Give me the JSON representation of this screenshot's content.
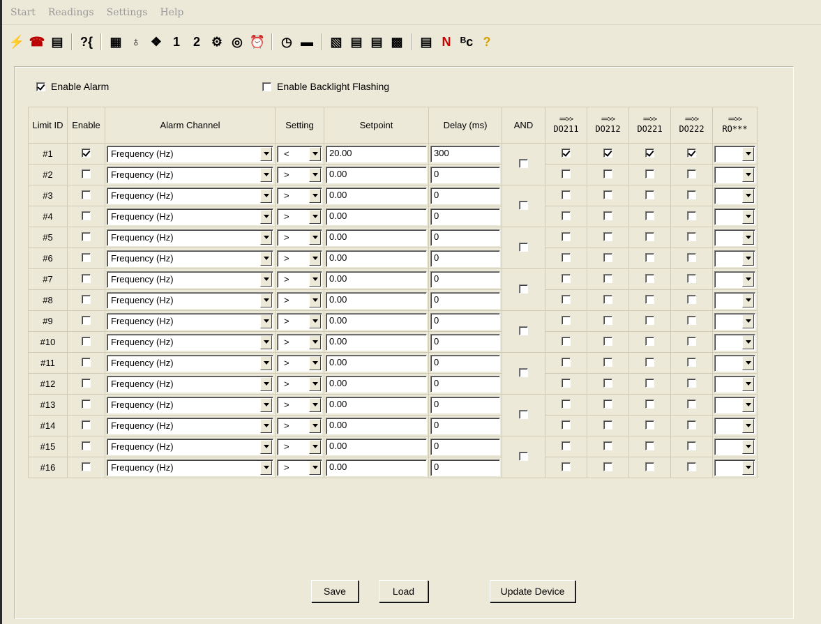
{
  "menu": [
    "Start",
    "Readings",
    "Settings",
    "Help"
  ],
  "toolbar_icons": [
    {
      "name": "connect-icon",
      "glyph": "⚡"
    },
    {
      "name": "phone-icon",
      "glyph": "☎"
    },
    {
      "name": "device-list-icon",
      "glyph": "▤"
    },
    {
      "name": "sep"
    },
    {
      "name": "query-icon",
      "glyph": "?{"
    },
    {
      "name": "sep"
    },
    {
      "name": "meter-icon",
      "glyph": "▦"
    },
    {
      "name": "lamp-icon",
      "glyph": "♁"
    },
    {
      "name": "cube-icon",
      "glyph": "❖"
    },
    {
      "name": "one-icon",
      "glyph": "1"
    },
    {
      "name": "two-icon",
      "glyph": "2"
    },
    {
      "name": "network-icon",
      "glyph": "⚙"
    },
    {
      "name": "target-icon",
      "glyph": "◎"
    },
    {
      "name": "alarm-clock-icon",
      "glyph": "⏰"
    },
    {
      "name": "sep"
    },
    {
      "name": "clock-icon",
      "glyph": "◷"
    },
    {
      "name": "battery-icon",
      "glyph": "▬"
    },
    {
      "name": "sep"
    },
    {
      "name": "document-icon",
      "glyph": "▧"
    },
    {
      "name": "document-1-icon",
      "glyph": "▤"
    },
    {
      "name": "document-2-icon",
      "glyph": "▤"
    },
    {
      "name": "grid-icon",
      "glyph": "▩"
    },
    {
      "name": "sep"
    },
    {
      "name": "document-n-icon",
      "glyph": "▤"
    },
    {
      "name": "n-icon",
      "glyph": "N"
    },
    {
      "name": "bc-icon",
      "glyph": "ᴮᴄ"
    },
    {
      "name": "help-icon",
      "glyph": "?"
    }
  ],
  "options": {
    "enable_alarm": {
      "label": "Enable Alarm",
      "checked": true
    },
    "enable_backlight": {
      "label": "Enable Backlight Flashing",
      "checked": false
    }
  },
  "headers": {
    "limit_id": "Limit ID",
    "enable": "Enable",
    "alarm_channel": "Alarm Channel",
    "setting": "Setting",
    "setpoint": "Setpoint",
    "delay": "Delay (ms)",
    "and": "AND",
    "arrow": "==>>",
    "do211": "DO211",
    "do212": "DO212",
    "do221": "DO221",
    "do222": "DO222",
    "ro": "RO***"
  },
  "rows": [
    {
      "id": "#1",
      "enable": true,
      "channel": "Frequency (Hz)",
      "setting": "<",
      "setpoint": "20.00",
      "delay": "300",
      "do": [
        true,
        true,
        true,
        true
      ]
    },
    {
      "id": "#2",
      "enable": false,
      "channel": "Frequency (Hz)",
      "setting": ">",
      "setpoint": "0.00",
      "delay": "0",
      "do": [
        false,
        false,
        false,
        false
      ]
    },
    {
      "id": "#3",
      "enable": false,
      "channel": "Frequency (Hz)",
      "setting": ">",
      "setpoint": "0.00",
      "delay": "0",
      "do": [
        false,
        false,
        false,
        false
      ]
    },
    {
      "id": "#4",
      "enable": false,
      "channel": "Frequency (Hz)",
      "setting": ">",
      "setpoint": "0.00",
      "delay": "0",
      "do": [
        false,
        false,
        false,
        false
      ]
    },
    {
      "id": "#5",
      "enable": false,
      "channel": "Frequency (Hz)",
      "setting": ">",
      "setpoint": "0.00",
      "delay": "0",
      "do": [
        false,
        false,
        false,
        false
      ]
    },
    {
      "id": "#6",
      "enable": false,
      "channel": "Frequency (Hz)",
      "setting": ">",
      "setpoint": "0.00",
      "delay": "0",
      "do": [
        false,
        false,
        false,
        false
      ]
    },
    {
      "id": "#7",
      "enable": false,
      "channel": "Frequency (Hz)",
      "setting": ">",
      "setpoint": "0.00",
      "delay": "0",
      "do": [
        false,
        false,
        false,
        false
      ]
    },
    {
      "id": "#8",
      "enable": false,
      "channel": "Frequency (Hz)",
      "setting": ">",
      "setpoint": "0.00",
      "delay": "0",
      "do": [
        false,
        false,
        false,
        false
      ]
    },
    {
      "id": "#9",
      "enable": false,
      "channel": "Frequency (Hz)",
      "setting": ">",
      "setpoint": "0.00",
      "delay": "0",
      "do": [
        false,
        false,
        false,
        false
      ]
    },
    {
      "id": "#10",
      "enable": false,
      "channel": "Frequency (Hz)",
      "setting": ">",
      "setpoint": "0.00",
      "delay": "0",
      "do": [
        false,
        false,
        false,
        false
      ]
    },
    {
      "id": "#11",
      "enable": false,
      "channel": "Frequency (Hz)",
      "setting": ">",
      "setpoint": "0.00",
      "delay": "0",
      "do": [
        false,
        false,
        false,
        false
      ]
    },
    {
      "id": "#12",
      "enable": false,
      "channel": "Frequency (Hz)",
      "setting": ">",
      "setpoint": "0.00",
      "delay": "0",
      "do": [
        false,
        false,
        false,
        false
      ]
    },
    {
      "id": "#13",
      "enable": false,
      "channel": "Frequency (Hz)",
      "setting": ">",
      "setpoint": "0.00",
      "delay": "0",
      "do": [
        false,
        false,
        false,
        false
      ]
    },
    {
      "id": "#14",
      "enable": false,
      "channel": "Frequency (Hz)",
      "setting": ">",
      "setpoint": "0.00",
      "delay": "0",
      "do": [
        false,
        false,
        false,
        false
      ]
    },
    {
      "id": "#15",
      "enable": false,
      "channel": "Frequency (Hz)",
      "setting": ">",
      "setpoint": "0.00",
      "delay": "0",
      "do": [
        false,
        false,
        false,
        false
      ]
    },
    {
      "id": "#16",
      "enable": false,
      "channel": "Frequency (Hz)",
      "setting": ">",
      "setpoint": "0.00",
      "delay": "0",
      "do": [
        false,
        false,
        false,
        false
      ]
    }
  ],
  "and_groups": [
    false,
    false,
    false,
    false,
    false,
    false,
    false,
    false
  ],
  "buttons": {
    "save": "Save",
    "load": "Load",
    "update": "Update Device"
  }
}
